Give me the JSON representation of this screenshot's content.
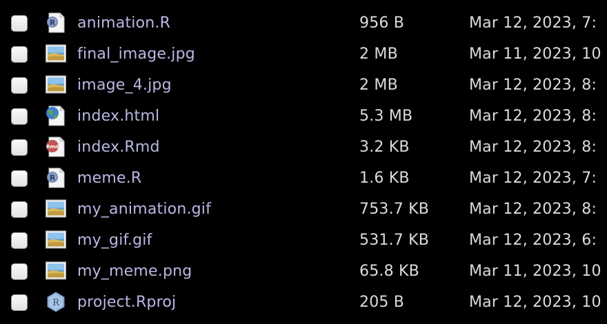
{
  "files": [
    {
      "name": "animation.R",
      "size": "956 B",
      "modified": "Mar 12, 2023, 7:",
      "icon": "r-script-icon"
    },
    {
      "name": "final_image.jpg",
      "size": "2 MB",
      "modified": "Mar 11, 2023, 10",
      "icon": "image-file-icon"
    },
    {
      "name": "image_4.jpg",
      "size": "2 MB",
      "modified": "Mar 12, 2023, 8:",
      "icon": "image-file-icon"
    },
    {
      "name": "index.html",
      "size": "5.3 MB",
      "modified": "Mar 12, 2023, 8:",
      "icon": "html-file-icon"
    },
    {
      "name": "index.Rmd",
      "size": "3.2 KB",
      "modified": "Mar 12, 2023, 8:",
      "icon": "rmd-file-icon"
    },
    {
      "name": "meme.R",
      "size": "1.6 KB",
      "modified": "Mar 12, 2023, 7:",
      "icon": "r-script-icon"
    },
    {
      "name": "my_animation.gif",
      "size": "753.7 KB",
      "modified": "Mar 12, 2023, 8:",
      "icon": "image-file-icon"
    },
    {
      "name": "my_gif.gif",
      "size": "531.7 KB",
      "modified": "Mar 12, 2023, 6:",
      "icon": "image-file-icon"
    },
    {
      "name": "my_meme.png",
      "size": "65.8 KB",
      "modified": "Mar 11, 2023, 10",
      "icon": "image-file-icon"
    },
    {
      "name": "project.Rproj",
      "size": "205 B",
      "modified": "Mar 12, 2023, 10",
      "icon": "rproj-file-icon"
    }
  ],
  "colors": {
    "background": "#000000",
    "file_name": "#b8b8e4",
    "text": "#dcdcdc"
  }
}
